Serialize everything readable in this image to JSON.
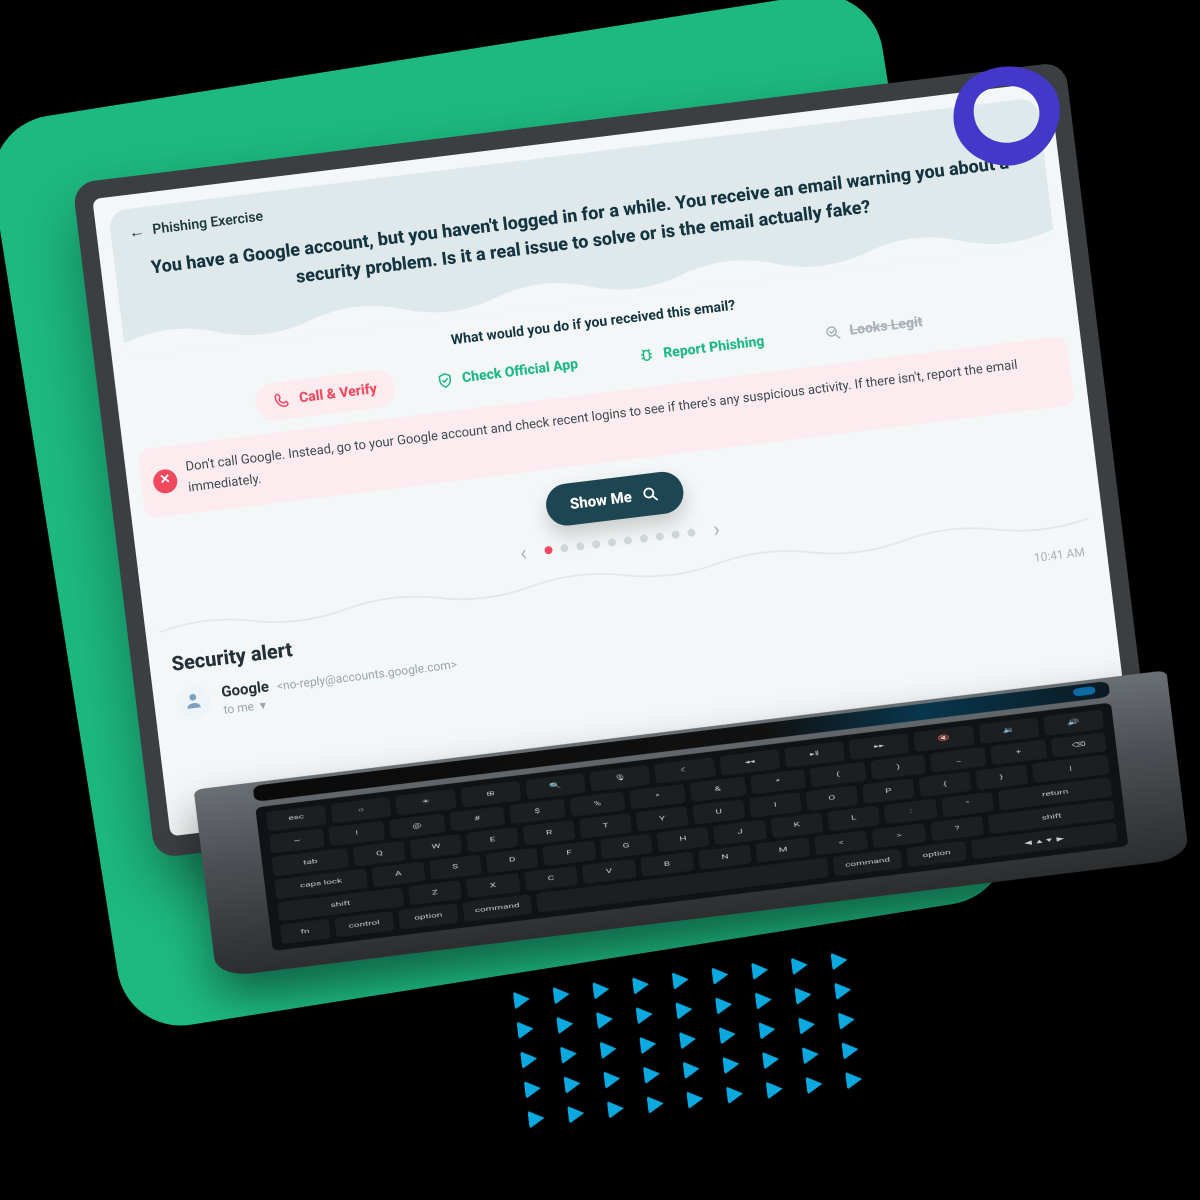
{
  "breadcrumb": {
    "back_label": "Phishing Exercise"
  },
  "scenario": {
    "text": "You have a Google account, but you haven't logged in for a while. You receive an email warning you about a security problem. Is it a real issue to solve or is the email actually fake?",
    "prompt": "What would you do if you received this email?"
  },
  "choices": {
    "call_verify": "Call & Verify",
    "check_app": "Check Official App",
    "report": "Report Phishing",
    "legit": "Looks Legit"
  },
  "hint": {
    "text": "Don't call Google. Instead, go to your Google account and check recent logins to see if there's any suspicious activity. If there isn't, report the email immediately."
  },
  "action": {
    "show_me": "Show Me"
  },
  "pager": {
    "total": 10,
    "current": 1
  },
  "email": {
    "subject": "Security alert",
    "sender_name": "Google",
    "sender_address": "<no-reply@accounts.google.com>",
    "recipient_label": "to me",
    "time": "10:41 AM"
  },
  "icons": {
    "phone": "phone-icon",
    "shield": "shield-check-icon",
    "bug": "bug-report-icon",
    "search": "search-check-icon",
    "magnifier": "magnifier-icon",
    "close": "close-circle-icon",
    "back": "arrow-left-icon",
    "chevron_left": "chevron-left-icon",
    "chevron_right": "chevron-right-icon",
    "chevron_down": "chevron-down-icon",
    "avatar": "person-icon",
    "logo": "brand-play-logo"
  },
  "colors": {
    "brand_green": "#1db981",
    "accent_red": "#f0495e",
    "button_teal": "#1e4552",
    "indigo": "#4338ca",
    "cyan": "#0ba9df"
  }
}
